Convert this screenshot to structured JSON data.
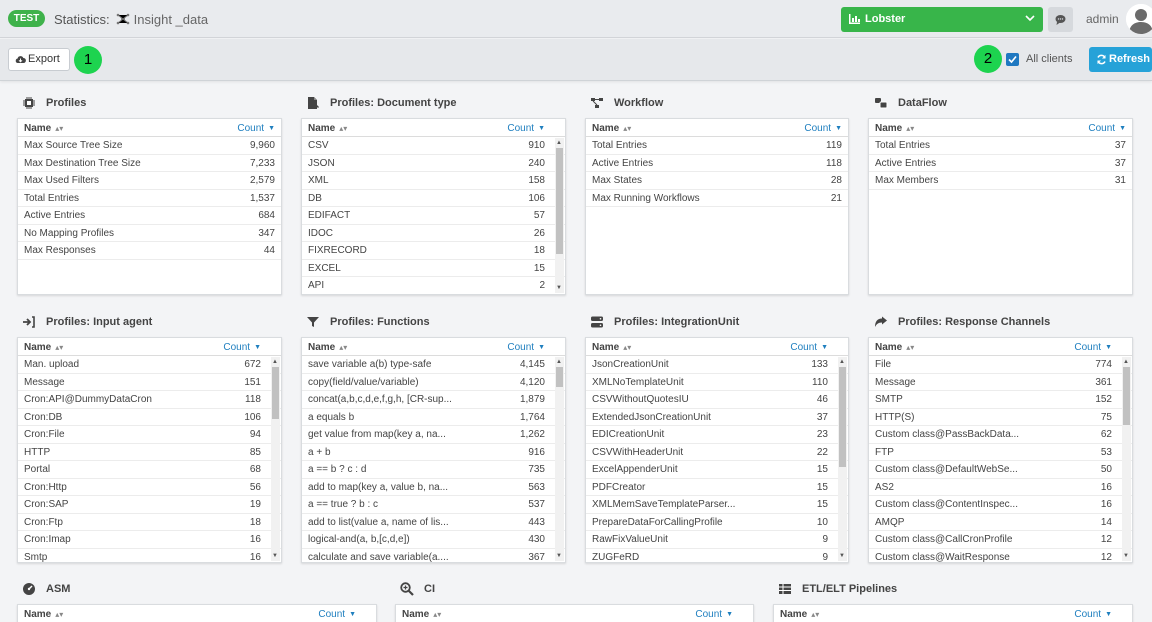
{
  "header": {
    "badge": "TEST",
    "app": "Statistics:",
    "page": "Insight _data",
    "client": "Lobster",
    "user": "admin"
  },
  "toolbar": {
    "export_label": "Export",
    "marker1": "1",
    "marker2": "2",
    "all_clients_label": "All clients",
    "refresh_label": "Refresh"
  },
  "table": {
    "name_header": "Name",
    "count_header": "Count"
  },
  "panels": [
    {
      "title": "Profiles",
      "icon": "cpu-icon",
      "rows": [
        [
          "Max Source Tree Size",
          "9,960"
        ],
        [
          "Max Destination Tree Size",
          "7,233"
        ],
        [
          "Max Used Filters",
          "2,579"
        ],
        [
          "Total Entries",
          "1,537"
        ],
        [
          "Active Entries",
          "684"
        ],
        [
          "No Mapping Profiles",
          "347"
        ],
        [
          "Max Responses",
          "44"
        ]
      ]
    },
    {
      "title": "Profiles: Document type",
      "icon": "document-icon",
      "rows": [
        [
          "CSV",
          "910"
        ],
        [
          "JSON",
          "240"
        ],
        [
          "XML",
          "158"
        ],
        [
          "DB",
          "106"
        ],
        [
          "EDIFACT",
          "57"
        ],
        [
          "IDOC",
          "26"
        ],
        [
          "FIXRECORD",
          "18"
        ],
        [
          "EXCEL",
          "15"
        ],
        [
          "API",
          "2"
        ]
      ]
    },
    {
      "title": "Workflow",
      "icon": "workflow-icon",
      "rows": [
        [
          "Total Entries",
          "119"
        ],
        [
          "Active Entries",
          "118"
        ],
        [
          "Max States",
          "28"
        ],
        [
          "Max Running Workflows",
          "21"
        ]
      ]
    },
    {
      "title": "DataFlow",
      "icon": "dataflow-icon",
      "rows": [
        [
          "Total Entries",
          "37"
        ],
        [
          "Active Entries",
          "37"
        ],
        [
          "Max Members",
          "31"
        ]
      ]
    },
    {
      "title": "Profiles: Input agent",
      "icon": "sign-in-icon",
      "rows": [
        [
          "Man. upload",
          "672"
        ],
        [
          "Message",
          "151"
        ],
        [
          "Cron:API@DummyDataCron",
          "118"
        ],
        [
          "Cron:DB",
          "106"
        ],
        [
          "Cron:File",
          "94"
        ],
        [
          "HTTP",
          "85"
        ],
        [
          "Portal",
          "68"
        ],
        [
          "Cron:Http",
          "56"
        ],
        [
          "Cron:SAP",
          "19"
        ],
        [
          "Cron:Ftp",
          "18"
        ],
        [
          "Cron:Imap",
          "16"
        ],
        [
          "Smtp",
          "16"
        ]
      ]
    },
    {
      "title": "Profiles: Functions",
      "icon": "filter-icon",
      "rows": [
        [
          "save variable a(b) type-safe",
          "4,145"
        ],
        [
          "copy(field/value/variable)",
          "4,120"
        ],
        [
          "concat(a,b,c,d,e,f,g,h, [CR-sup...",
          "1,879"
        ],
        [
          "a equals b",
          "1,764"
        ],
        [
          "get value from map(key a, na...",
          "1,262"
        ],
        [
          "a + b",
          "916"
        ],
        [
          "a == b ? c : d",
          "735"
        ],
        [
          "add to map(key a, value b, na...",
          "563"
        ],
        [
          "a == true ? b : c",
          "537"
        ],
        [
          "add to list(value a, name of lis...",
          "443"
        ],
        [
          "logical-and(a, b,[c,d,e])",
          "430"
        ],
        [
          "calculate and save variable(a....",
          "367"
        ]
      ]
    },
    {
      "title": "Profiles: IntegrationUnit",
      "icon": "server-icon",
      "rows": [
        [
          "JsonCreationUnit",
          "133"
        ],
        [
          "XMLNoTemplateUnit",
          "110"
        ],
        [
          "CSVWithoutQuotesIU",
          "46"
        ],
        [
          "ExtendedJsonCreationUnit",
          "37"
        ],
        [
          "EDICreationUnit",
          "23"
        ],
        [
          "CSVWithHeaderUnit",
          "22"
        ],
        [
          "ExcelAppenderUnit",
          "15"
        ],
        [
          "PDFCreator",
          "15"
        ],
        [
          "XMLMemSaveTemplateParser...",
          "15"
        ],
        [
          "PrepareDataForCallingProfile",
          "10"
        ],
        [
          "RawFixValueUnit",
          "9"
        ],
        [
          "ZUGFeRD",
          "9"
        ]
      ]
    },
    {
      "title": "Profiles: Response Channels",
      "icon": "share-icon",
      "rows": [
        [
          "File",
          "774"
        ],
        [
          "Message",
          "361"
        ],
        [
          "SMTP",
          "152"
        ],
        [
          "HTTP(S)",
          "75"
        ],
        [
          "Custom class@PassBackData...",
          "62"
        ],
        [
          "FTP",
          "53"
        ],
        [
          "Custom class@DefaultWebSe...",
          "50"
        ],
        [
          "AS2",
          "16"
        ],
        [
          "Custom class@ContentInspec...",
          "16"
        ],
        [
          "AMQP",
          "14"
        ],
        [
          "Custom class@CallCronProfile",
          "12"
        ],
        [
          "Custom class@WaitResponse",
          "12"
        ]
      ]
    },
    {
      "title": "ASM",
      "icon": "dashboard-icon",
      "rows": []
    },
    {
      "title": "CI",
      "icon": "search-plus-icon",
      "rows": []
    },
    {
      "title": "ETL/ELT Pipelines",
      "icon": "table-icon",
      "rows": []
    }
  ]
}
